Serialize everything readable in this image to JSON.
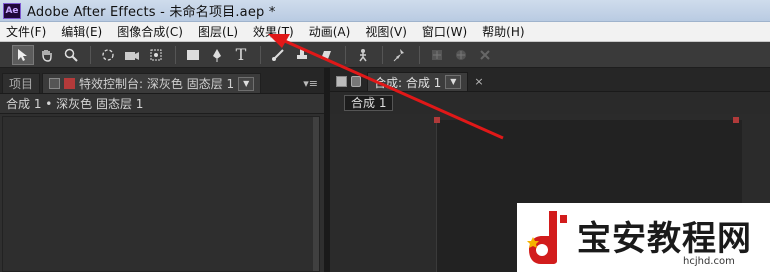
{
  "window": {
    "title": "Adobe After Effects - 未命名项目.aep *",
    "app_icon": "Ae"
  },
  "menu": [
    "文件(F)",
    "编辑(E)",
    "图像合成(C)",
    "图层(L)",
    "效果(T)",
    "动画(A)",
    "视图(V)",
    "窗口(W)",
    "帮助(H)"
  ],
  "tools": [
    "select-arrow-icon",
    "hand-icon",
    "zoom-icon",
    "rotate-icon",
    "camera-icon",
    "pan-behind-icon",
    "rectangle-mask-icon",
    "pen-icon",
    "text-icon",
    "brush-icon",
    "clone-stamp-icon",
    "eraser-icon",
    "roto-brush-icon",
    "puppet-pin-icon",
    "local-axis-icon",
    "world-axis-icon",
    "view-axis-icon"
  ],
  "left_panel": {
    "tab_project": "项目",
    "tab_effects": "特效控制台: 深灰色 固态层 1",
    "breadcrumb": "合成 1 • 深灰色 固态层 1"
  },
  "right_panel": {
    "tab_comp": "合成: 合成 1",
    "comp_chip": "合成 1"
  },
  "colors": {
    "accent_arrow": "#e01818",
    "solid_swatch": "#b43a3a"
  },
  "watermark": {
    "text": "宝安教程网",
    "url": "hcjhd.com"
  }
}
